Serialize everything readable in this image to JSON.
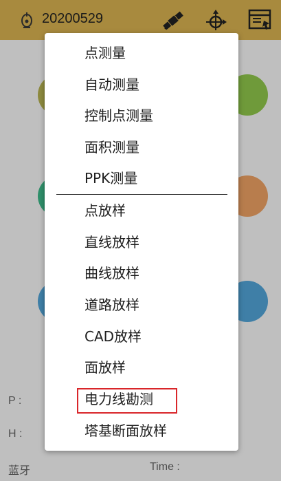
{
  "header": {
    "project_name": "20200529",
    "icons": [
      "logo-icon",
      "satellite-icon",
      "target-icon",
      "panel-icon"
    ]
  },
  "status": {
    "p_label": "P :",
    "h_label": "H :",
    "bluetooth_label": "蓝牙",
    "time_label": "Time :"
  },
  "menu": {
    "group1": [
      "点测量",
      "自动测量",
      "控制点测量",
      "面积测量",
      "PPK测量"
    ],
    "group2": [
      "点放样",
      "直线放样",
      "曲线放样",
      "道路放样",
      "CAD放样",
      "面放样",
      "电力线勘测",
      "塔基断面放样"
    ],
    "highlighted_item": "电力线勘测"
  },
  "colors": {
    "header_bg": "#a88a3e",
    "highlight": "#d9262a"
  }
}
